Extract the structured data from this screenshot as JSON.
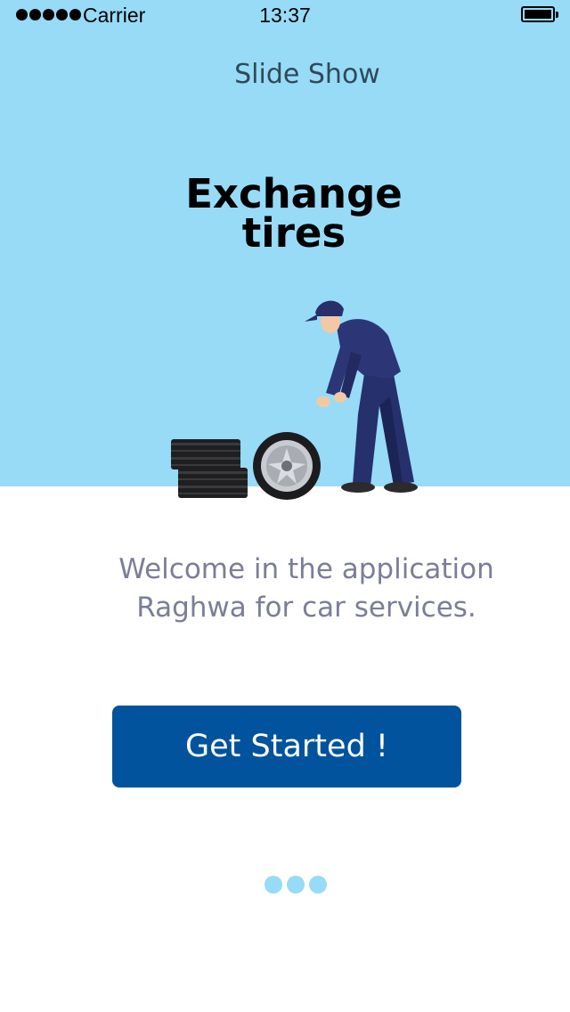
{
  "status_bar": {
    "carrier": "Carrier",
    "time": "13:37"
  },
  "header": {
    "title": "Slide Show"
  },
  "slide": {
    "headline_line1": "Exchange",
    "headline_line2": "tires",
    "illustration": "mechanic-with-tires-illustration"
  },
  "welcome": {
    "line1": "Welcome in the application",
    "line2": "Raghwa for car services."
  },
  "cta": {
    "label": "Get Started !"
  },
  "pagination": {
    "total": 3
  },
  "colors": {
    "hero_bg": "#97dbf7",
    "button_bg": "#00539c",
    "body_text": "#7b7e98",
    "page_dot": "#97dbf7"
  }
}
